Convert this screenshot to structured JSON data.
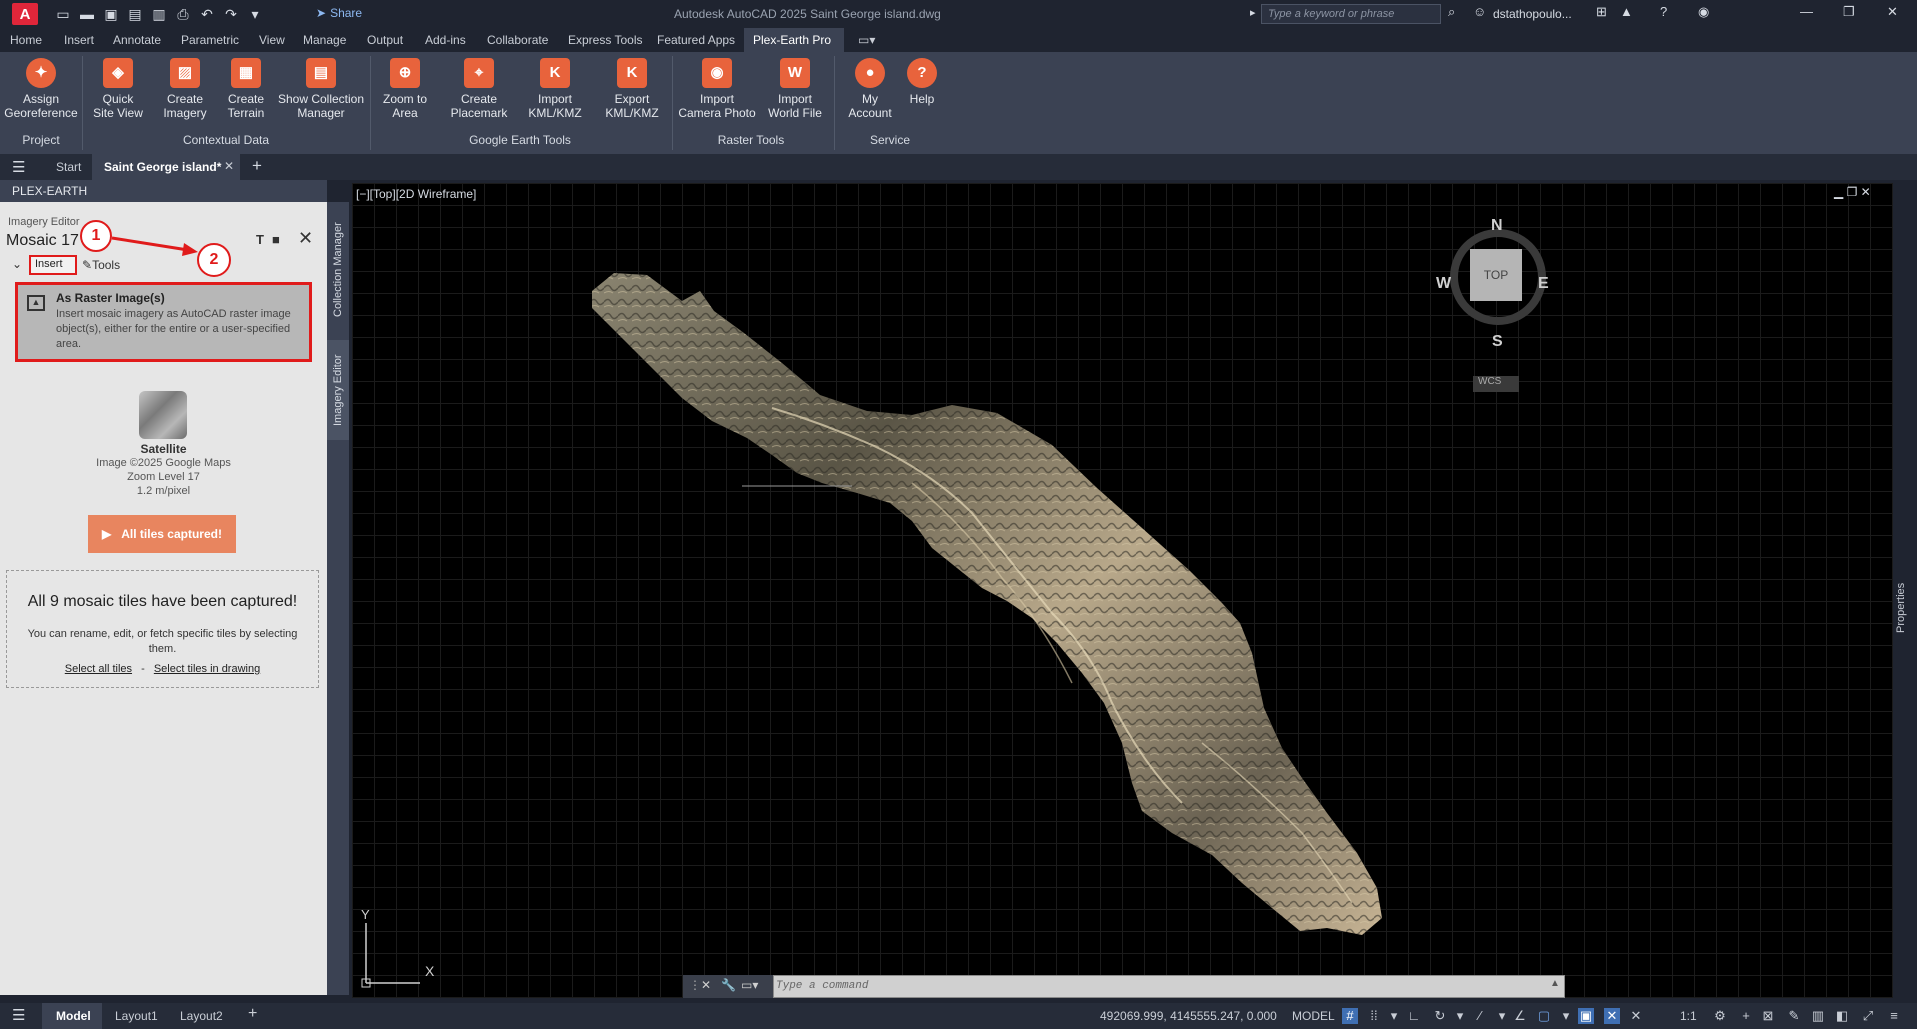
{
  "app": {
    "title": "Autodesk AutoCAD 2025    Saint George island.dwg",
    "logo_letter": "A",
    "share": "Share",
    "search_placeholder": "Type a keyword or phrase",
    "user": "dstathopoulo..."
  },
  "menu_tabs": [
    "Home",
    "Insert",
    "Annotate",
    "Parametric",
    "View",
    "Manage",
    "Output",
    "Add-ins",
    "Collaborate",
    "Express Tools",
    "Featured Apps",
    "Plex-Earth Pro"
  ],
  "ribbon": {
    "buttons": [
      {
        "l1": "Assign",
        "l2": "Georeference"
      },
      {
        "l1": "Quick",
        "l2": "Site View"
      },
      {
        "l1": "Create",
        "l2": "Imagery"
      },
      {
        "l1": "Create",
        "l2": "Terrain"
      },
      {
        "l1": "Show Collection",
        "l2": "Manager"
      },
      {
        "l1": "Zoom to",
        "l2": "Area"
      },
      {
        "l1": "Create",
        "l2": "Placemark"
      },
      {
        "l1": "Import",
        "l2": "KML/KMZ"
      },
      {
        "l1": "Export",
        "l2": "KML/KMZ"
      },
      {
        "l1": "Import",
        "l2": "Camera Photo"
      },
      {
        "l1": "Import",
        "l2": "World File"
      },
      {
        "l1": "My",
        "l2": "Account"
      },
      {
        "l1": "Help",
        "l2": ""
      }
    ],
    "groups": [
      "Project",
      "Contextual Data",
      "Google Earth Tools",
      "Raster Tools",
      "Service"
    ]
  },
  "file_tabs": {
    "start": "Start",
    "active": "Saint George island*"
  },
  "palette": {
    "header": "PLEX-EARTH",
    "section": "Imagery Editor",
    "mosaic": "Mosaic 17",
    "tab_insert": "Insert",
    "tab_tools": "Tools",
    "raster_title": "As Raster Image(s)",
    "raster_desc": "Insert mosaic imagery as AutoCAD raster image object(s), either for the entire or a user-specified area.",
    "provider": "Satellite",
    "credit": "Image ©2025 Google Maps",
    "zoom": "Zoom Level 17",
    "resolution": "1.2 m/pixel",
    "capture_btn": "All tiles captured!",
    "done_title": "All 9 mosaic tiles have been captured!",
    "done_desc": "You can rename, edit, or fetch specific tiles by selecting them.",
    "link_all": "Select all tiles",
    "link_sep": "-",
    "link_drawing": "Select tiles in drawing",
    "step1": "1",
    "step2": "2",
    "vtab_collection": "Collection Manager",
    "vtab_imagery": "Imagery Editor"
  },
  "viewport": {
    "label": "[−][Top][2D Wireframe]",
    "compass": {
      "n": "N",
      "s": "S",
      "e": "E",
      "w": "W",
      "top": "TOP",
      "wcs": "WCS"
    },
    "ucs_y": "Y",
    "ucs_x": "X",
    "cmd_placeholder": "Type a command",
    "properties": "Properties"
  },
  "status": {
    "model": "Model",
    "layout1": "Layout1",
    "layout2": "Layout2",
    "coords": "492069.999, 4145555.247, 0.000",
    "space": "MODEL",
    "scale": "1:1"
  },
  "colors": {
    "accent": "#e8633c",
    "highlight": "#e01b1b",
    "ribbon": "#3b4253"
  }
}
